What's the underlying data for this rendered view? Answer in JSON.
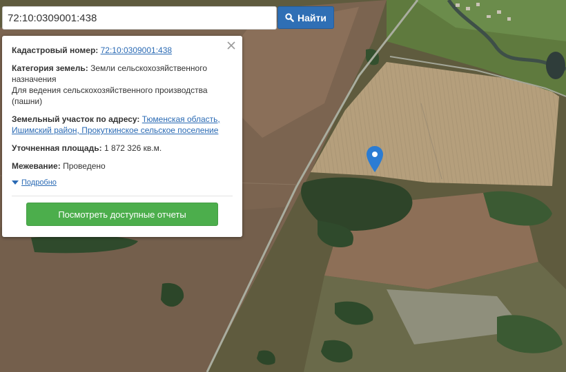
{
  "search": {
    "value": "72:10:0309001:438",
    "button_label": "Найти"
  },
  "popup": {
    "cadastral_label": "Кадастровый номер:",
    "cadastral_value": "72:10:0309001:438",
    "category_label": "Категория земель:",
    "category_value": "Земли сельскохозяйственного назначения",
    "usage_value": "Для ведения сельскохозяйственного производства (пашни)",
    "address_label": "Земельный участок по адресу:",
    "address_value": "Тюменская область, Ишимский район, Прокуткинское сельское поселение",
    "area_label": "Уточненная площадь:",
    "area_value": "1 872 326 кв.м.",
    "survey_label": "Межевание:",
    "survey_value": "Проведено",
    "details_label": "Подробно",
    "report_button_label": "Посмотреть доступные отчеты"
  },
  "colors": {
    "search_button": "#2f6fb5",
    "report_button": "#4cae4c",
    "link": "#2a6ab4",
    "pin": "#2b7cd3"
  },
  "icons": [
    "search-icon",
    "close-icon",
    "caret-down-icon",
    "map-pin-icon"
  ]
}
